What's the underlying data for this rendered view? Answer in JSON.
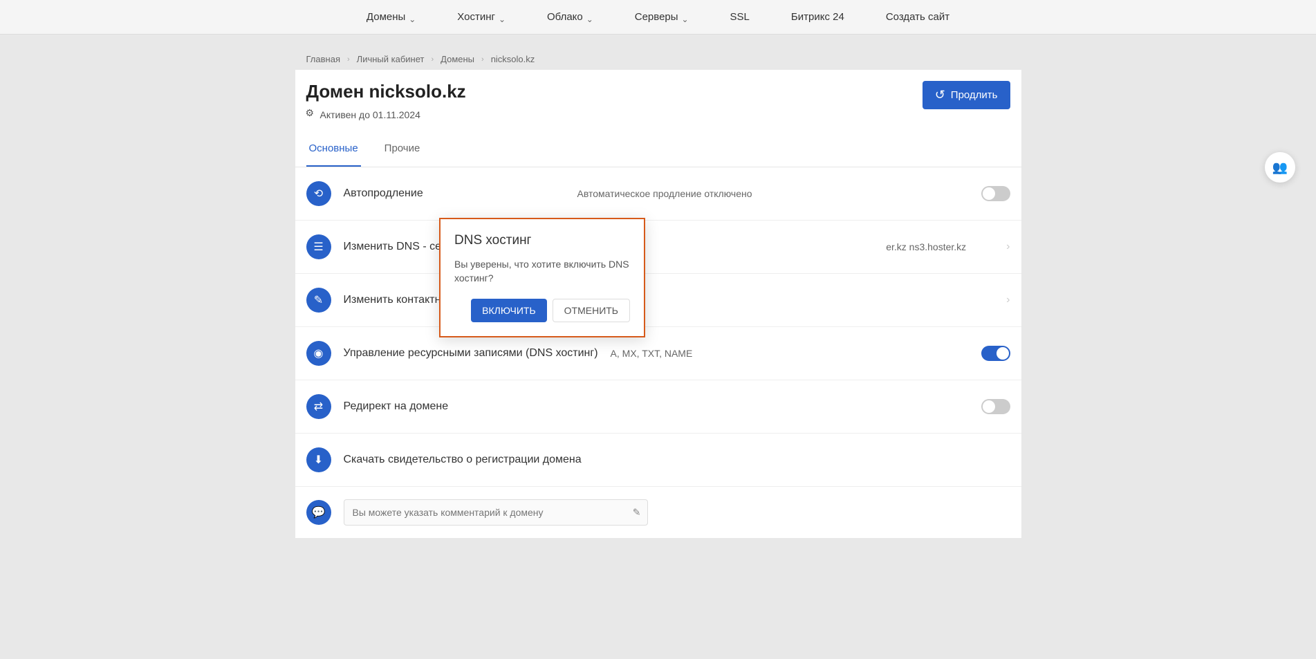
{
  "nav": {
    "items": [
      {
        "label": "Домены",
        "hasDropdown": true
      },
      {
        "label": "Хостинг",
        "hasDropdown": true
      },
      {
        "label": "Облако",
        "hasDropdown": true
      },
      {
        "label": "Серверы",
        "hasDropdown": true
      },
      {
        "label": "SSL",
        "hasDropdown": false
      },
      {
        "label": "Битрикс 24",
        "hasDropdown": false
      },
      {
        "label": "Создать сайт",
        "hasDropdown": false
      }
    ]
  },
  "breadcrumb": {
    "items": [
      "Главная",
      "Личный кабинет",
      "Домены",
      "nicksolo.kz"
    ]
  },
  "page": {
    "title": "Домен nicksolo.kz",
    "status": "Активен до 01.11.2024",
    "renewButton": "Продлить"
  },
  "tabs": {
    "items": [
      {
        "label": "Основные",
        "active": true
      },
      {
        "label": "Прочие",
        "active": false
      }
    ]
  },
  "settings": {
    "autorenew": {
      "label": "Автопродление",
      "value": "Автоматическое продление отключено",
      "enabled": false
    },
    "dns_servers": {
      "label": "Изменить DNS - серверы",
      "value": "er.kz ns3.hoster.kz"
    },
    "contact_data": {
      "label": "Изменить контактные данные владельца"
    },
    "dns_hosting": {
      "label": "Управление ресурсными записями (DNS хостинг)",
      "value": "A, MX, TXT, NAME",
      "enabled": true
    },
    "redirect": {
      "label": "Редирект на домене",
      "enabled": false
    },
    "download_cert": {
      "label": "Скачать свидетельство о регистрации домена"
    },
    "comment": {
      "placeholder": "Вы можете указать комментарий к домену"
    }
  },
  "modal": {
    "title": "DNS хостинг",
    "text": "Вы уверены, что хотите включить DNS хостинг?",
    "confirm": "ВКЛЮЧИТЬ",
    "cancel": "ОТМЕНИТЬ"
  }
}
